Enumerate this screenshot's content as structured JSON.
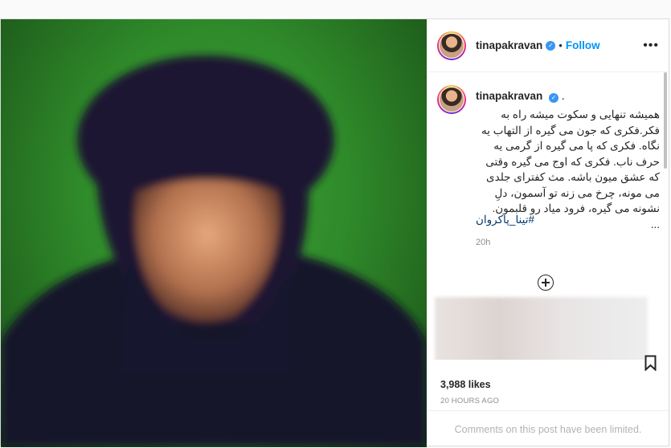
{
  "post": {
    "username": "tinapakravan",
    "follow_label": "Follow",
    "caption_suffix": ".",
    "caption_text": "همیشه تنهایی و سکوت میشه راه به فکر.فکری که جون می گیره از التهاب یه نگاه. فکری که پا می گیره از گرمی یه حرف ناب. فکری که اوج می گیره وقتی که عشق میون باشه. مث کفترای جلدی می مونه، چرخ می زنه تو آسمون، دلِ نشونه می گیره، فرود میاد رو قلبمون.\n...",
    "hashtag": "#تینا_پاکروان",
    "caption_time": "20h",
    "likes": "3,988 likes",
    "date": "20 HOURS AGO",
    "comments_limited": "Comments on this post have been limited."
  },
  "icons": {
    "verified": "verified-badge-icon",
    "more": "more-options-icon",
    "load_more": "plus-circle-icon",
    "bookmark": "bookmark-icon"
  },
  "colors": {
    "accent": "#0095f6",
    "photo_background": "#3da332"
  }
}
